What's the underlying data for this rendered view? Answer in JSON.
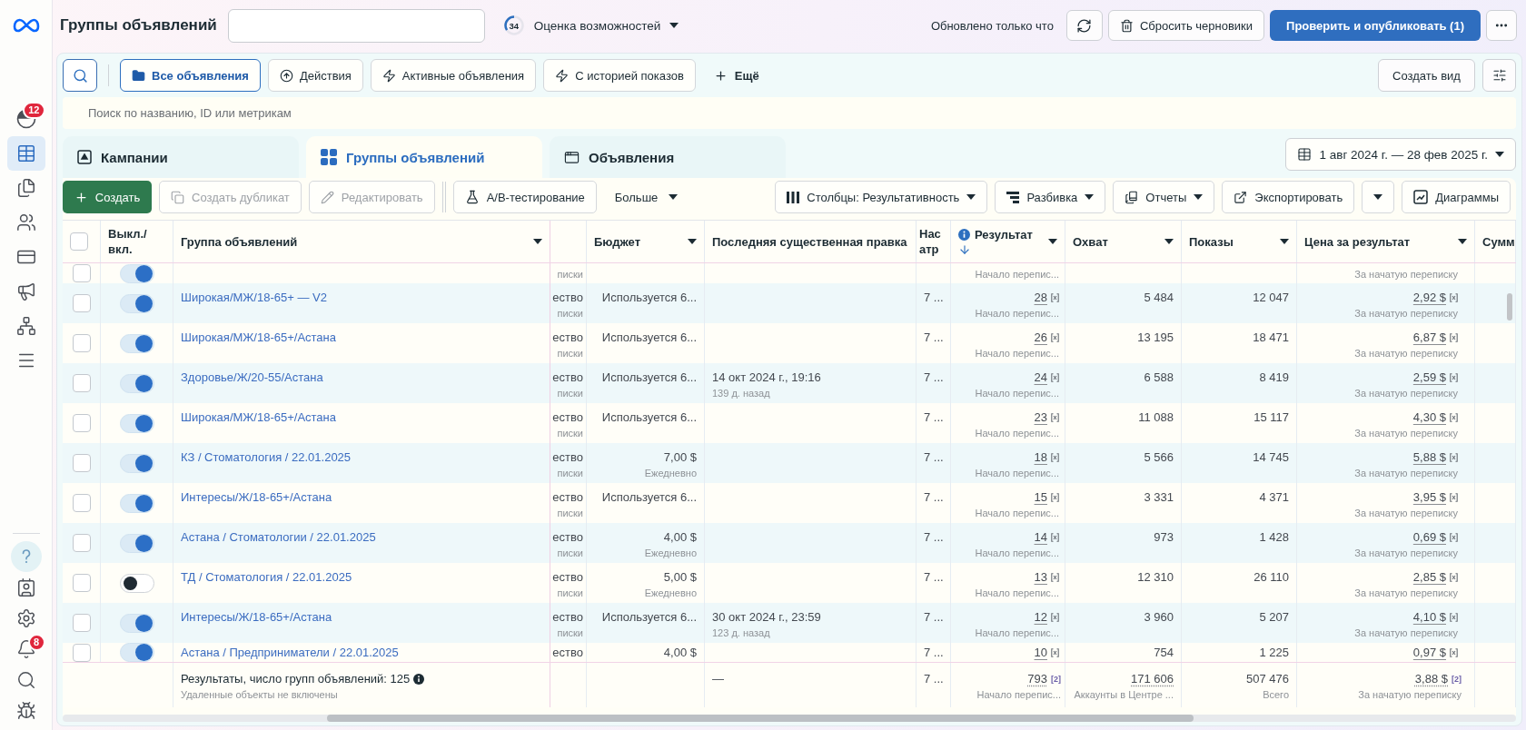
{
  "sidebar": {
    "top_items": [
      {
        "selected": false,
        "badge": "12"
      },
      {
        "selected": true
      },
      {
        "selected": false
      },
      {
        "selected": false
      },
      {
        "selected": false
      },
      {
        "selected": false
      },
      {
        "selected": false
      },
      {
        "selected": false
      }
    ],
    "bottom_items": [
      {
        "selected": false
      },
      {
        "selected": false
      },
      {
        "selected": false
      },
      {
        "selected": false,
        "badge": "8"
      },
      {
        "selected": false
      },
      {
        "selected": false
      }
    ]
  },
  "header": {
    "title": "Группы объявлений",
    "score": {
      "value": "34",
      "level": 0.34,
      "label": "Оценка возможностей"
    },
    "status": "Обновлено только что",
    "reset_button": "Сбросить черновики",
    "publish_button": "Проверить и опубликовать (1)"
  },
  "filters": {
    "views": [
      {
        "label": "Все объявления",
        "selected": true
      },
      {
        "label": "Действия",
        "selected": false
      },
      {
        "label": "Активные объявления",
        "selected": false
      },
      {
        "label": "С историей показов",
        "selected": false
      }
    ],
    "more": "Ещё",
    "create_view": "Создать вид"
  },
  "search": {
    "placeholder": "Поиск по названию, ID или метрикам"
  },
  "tabs": [
    {
      "label": "Кампании",
      "selected": false
    },
    {
      "label": "Группы объявлений",
      "selected": true
    },
    {
      "label": "Объявления",
      "selected": false
    }
  ],
  "date_range": "1 авг 2024 г. — 28 фев 2025 г.",
  "toolbar": {
    "left": [
      {
        "kind": "primary",
        "label": "Создать",
        "disabled": false
      },
      {
        "kind": "outline",
        "label": "Создать дубликат",
        "disabled": true
      },
      {
        "kind": "outline",
        "label": "Редактировать",
        "disabled": true
      },
      {
        "kind": "outline",
        "label": "A/B-тестирование",
        "disabled": false
      },
      {
        "kind": "menu",
        "label": "Больше",
        "disabled": false
      }
    ],
    "right": [
      {
        "kind": "menu",
        "label": "Столбцы: Результативность"
      },
      {
        "kind": "menu",
        "label": "Разбивка"
      },
      {
        "kind": "menu",
        "label": "Отчеты"
      },
      {
        "kind": "button",
        "label": "Экспортировать"
      },
      {
        "kind": "caret"
      },
      {
        "kind": "button",
        "label": "Диаграммы"
      }
    ]
  },
  "table": {
    "select_all": {
      "checked": false
    },
    "columns": [
      {
        "label": "Выкл./ вкл.",
        "menu": false,
        "sorted": false,
        "info": false
      },
      {
        "label": "Группа объявлений",
        "menu": true,
        "sorted": false,
        "info": false
      },
      {
        "label": "Бюджет",
        "menu": true,
        "sorted": false,
        "info": false
      },
      {
        "label": "Последняя существенная правка",
        "menu": false,
        "sorted": false,
        "info": false
      },
      {
        "label": "Нас атр",
        "menu": false,
        "sorted": false,
        "info": false
      },
      {
        "label": "Результат",
        "menu": true,
        "sorted": true,
        "info": true
      },
      {
        "label": "Охват",
        "menu": true,
        "sorted": false,
        "info": false
      },
      {
        "label": "Показы",
        "menu": true,
        "sorted": false,
        "info": false
      },
      {
        "label": "Цена за результат",
        "menu": true,
        "sorted": false,
        "info": false
      },
      {
        "label": "Сумм",
        "menu": false,
        "sorted": false,
        "info": false
      }
    ],
    "rows": [
      {
        "kind": "clipped_top",
        "checked": false,
        "on": true,
        "column_4_sub": "писки",
        "result_sub": "Начало перепис...",
        "cost_sub": "За начатую переписку"
      },
      {
        "kind": "full",
        "checked": false,
        "on": true,
        "name": "Широкая/МЖ/18-65+ — V2",
        "column_4": "ество",
        "column_4_sub": "писки",
        "budget": "Используется 6...",
        "column_6": "7 ...",
        "result": "28",
        "result_sub": "Начало перепис...",
        "reach": "5 484",
        "impressions": "12 047",
        "cost": "2,92 $",
        "cost_sub": "За начатую переписку"
      },
      {
        "kind": "full",
        "checked": false,
        "on": true,
        "name": "Широкая/МЖ/18-65+/Астана",
        "column_4": "ество",
        "column_4_sub": "писки",
        "budget": "Используется 6...",
        "column_6": "7 ...",
        "result": "26",
        "result_sub": "Начало перепис...",
        "reach": "13 195",
        "impressions": "18 471",
        "cost": "6,87 $",
        "cost_sub": "За начатую переписку"
      },
      {
        "kind": "full",
        "checked": false,
        "on": true,
        "name": "Здоровье/Ж/20-55/Астана",
        "column_4": "ество",
        "column_4_sub": "писки",
        "budget": "Используется 6...",
        "last_edit": "14 окт 2024 г., 19:16",
        "last_edit_sub": "139 д. назад",
        "column_6": "7 ...",
        "result": "24",
        "result_sub": "Начало перепис...",
        "reach": "6 588",
        "impressions": "8 419",
        "cost": "2,59 $",
        "cost_sub": "За начатую переписку"
      },
      {
        "kind": "full",
        "checked": false,
        "on": true,
        "name": "Широкая/МЖ/18-65+/Астана",
        "column_4": "ество",
        "column_4_sub": "писки",
        "budget": "Используется 6...",
        "column_6": "7 ...",
        "result": "23",
        "result_sub": "Начало перепис...",
        "reach": "11 088",
        "impressions": "15 117",
        "cost": "4,30 $",
        "cost_sub": "За начатую переписку"
      },
      {
        "kind": "full",
        "checked": false,
        "on": true,
        "name": "КЗ / Стоматология / 22.01.2025",
        "column_4": "ество",
        "column_4_sub": "писки",
        "budget": "7,00 $",
        "budget_sub": "Ежедневно",
        "column_6": "7 ...",
        "result": "18",
        "result_sub": "Начало перепис...",
        "reach": "5 566",
        "impressions": "14 745",
        "cost": "5,88 $",
        "cost_sub": "За начатую переписку"
      },
      {
        "kind": "full",
        "checked": false,
        "on": true,
        "name": "Интересы/Ж/18-65+/Астана",
        "column_4": "ество",
        "column_4_sub": "писки",
        "budget": "Используется 6...",
        "column_6": "7 ...",
        "result": "15",
        "result_sub": "Начало перепис...",
        "reach": "3 331",
        "impressions": "4 371",
        "cost": "3,95 $",
        "cost_sub": "За начатую переписку"
      },
      {
        "kind": "full",
        "checked": false,
        "on": true,
        "name": "Астана / Стоматологии / 22.01.2025",
        "column_4": "ество",
        "column_4_sub": "писки",
        "budget": "4,00 $",
        "budget_sub": "Ежедневно",
        "column_6": "7 ...",
        "result": "14",
        "result_sub": "Начало перепис...",
        "reach": "973",
        "impressions": "1 428",
        "cost": "0,69 $",
        "cost_sub": "За начатую переписку"
      },
      {
        "kind": "full",
        "checked": false,
        "on": false,
        "name": "ТД / Стоматология / 22.01.2025",
        "column_4": "ество",
        "column_4_sub": "писки",
        "budget": "5,00 $",
        "budget_sub": "Ежедневно",
        "column_6": "7 ...",
        "result": "13",
        "result_sub": "Начало перепис...",
        "reach": "12 310",
        "impressions": "26 110",
        "cost": "2,85 $",
        "cost_sub": "За начатую переписку"
      },
      {
        "kind": "full",
        "checked": false,
        "on": true,
        "name": "Интересы/Ж/18-65+/Астана",
        "column_4": "ество",
        "column_4_sub": "писки",
        "budget": "Используется 6...",
        "last_edit": "30 окт 2024 г., 23:59",
        "last_edit_sub": "123 д. назад",
        "column_6": "7 ...",
        "result": "12",
        "result_sub": "Начало перепис...",
        "reach": "3 960",
        "impressions": "5 207",
        "cost": "4,10 $",
        "cost_sub": "За начатую переписку"
      },
      {
        "kind": "clipped_bottom",
        "checked": false,
        "on": true,
        "name": "Астана / Предприниматели / 22.01.2025",
        "column_4": "ество",
        "budget": "4,00 $",
        "column_6": "7 ...",
        "result": "10",
        "reach": "754",
        "impressions": "1 225",
        "cost": "0,97 $"
      }
    ],
    "footer": {
      "label": "Результаты, число групп объявлений: 125",
      "note": "Удаленные объекты не включены",
      "last_edit": "—",
      "column_6": "7 ...",
      "result": "793",
      "result_note": "[2]",
      "result_sub": "Начало перепис...",
      "reach": "171 606",
      "reach_sub": "Аккаунты в Центре ...",
      "impressions": "507 476",
      "impressions_sub": "Всего",
      "cost": "3,88 $",
      "cost_note": "[2]",
      "cost_sub": "За начатую переписку"
    }
  }
}
